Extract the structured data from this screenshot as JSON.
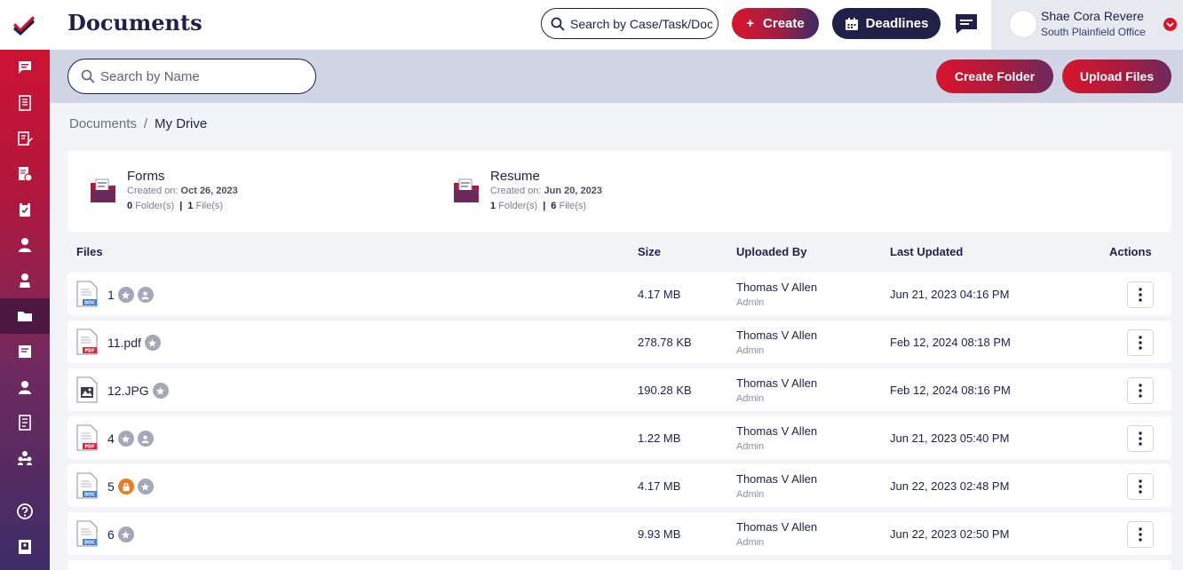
{
  "header": {
    "title": "Documents",
    "search_placeholder": "Search by Case/Task/Document",
    "create_label": "Create",
    "deadlines_label": "Deadlines"
  },
  "user": {
    "name": "Shae Cora Revere",
    "office": "South Plainfield Office"
  },
  "toolbar": {
    "search_placeholder": "Search by Name",
    "create_folder_label": "Create Folder",
    "upload_label": "Upload Files"
  },
  "breadcrumb": {
    "root": "Documents",
    "separator": "/",
    "current": "My Drive"
  },
  "folders": [
    {
      "name": "Forms",
      "created_label": "Created on:",
      "created": "Oct 26, 2023",
      "folder_count": "0",
      "folder_label": "Folder(s)",
      "file_count": "1",
      "file_label": "File(s)"
    },
    {
      "name": "Resume",
      "created_label": "Created on:",
      "created": "Jun 20, 2023",
      "folder_count": "1",
      "folder_label": "Folder(s)",
      "file_count": "6",
      "file_label": "File(s)"
    }
  ],
  "table": {
    "columns": {
      "files": "Files",
      "size": "Size",
      "uploaded_by": "Uploaded By",
      "last_updated": "Last Updated",
      "actions": "Actions"
    },
    "rows": [
      {
        "name": "1",
        "type": "doc",
        "size": "4.17 MB",
        "uploaded_by": "Thomas V Allen",
        "role": "Admin",
        "updated": "Jun 21, 2023 04:16 PM"
      },
      {
        "name": "11.pdf",
        "type": "pdf",
        "size": "278.78 KB",
        "uploaded_by": "Thomas V Allen",
        "role": "Admin",
        "updated": "Feb 12, 2024 08:18 PM"
      },
      {
        "name": "12.JPG",
        "type": "img",
        "size": "190.28 KB",
        "uploaded_by": "Thomas V Allen",
        "role": "Admin",
        "updated": "Feb 12, 2024 08:16 PM"
      },
      {
        "name": "4",
        "type": "pdf",
        "size": "1.22 MB",
        "uploaded_by": "Thomas V Allen",
        "role": "Admin",
        "updated": "Jun 21, 2023 05:40 PM"
      },
      {
        "name": "5",
        "type": "doc",
        "size": "4.17 MB",
        "uploaded_by": "Thomas V Allen",
        "role": "Admin",
        "updated": "Jun 22, 2023 02:48 PM"
      },
      {
        "name": "6",
        "type": "doc",
        "size": "9.93 MB",
        "uploaded_by": "Thomas V Allen",
        "role": "Admin",
        "updated": "Jun 22, 2023 02:50 PM"
      }
    ]
  },
  "file_type_labels": {
    "doc": "DOC",
    "pdf": "PDF"
  },
  "colors": {
    "brand_red": "#d8152e",
    "brand_navy": "#1f2148",
    "strip_bg": "#cfd5e5",
    "lock_orange": "#e67e22"
  }
}
